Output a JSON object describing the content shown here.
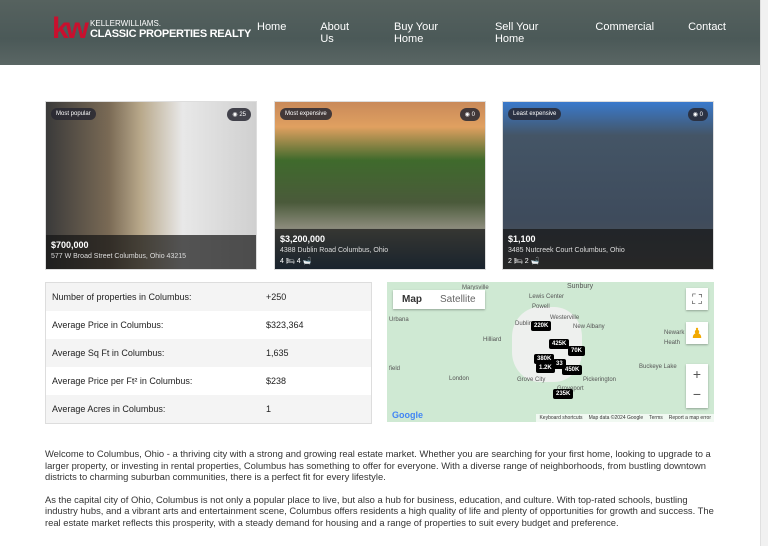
{
  "header": {
    "logo": {
      "mark": "kw",
      "line1": "KELLERWILLIAMS.",
      "line2": "CLASSIC PROPERTIES REALTY"
    },
    "nav": [
      "Home",
      "About Us",
      "Buy Your Home",
      "Sell Your Home",
      "Commercial",
      "Contact"
    ]
  },
  "cards": [
    {
      "badge": "Most popular",
      "views": "25",
      "price": "$700,000",
      "address": "577 W Broad Street Columbus, Ohio 43215",
      "beds": "",
      "baths": ""
    },
    {
      "badge": "Most expensive",
      "views": "0",
      "price": "$3,200,000",
      "address": "4388 Dublin Road Columbus, Ohio",
      "beds": "4",
      "baths": "4"
    },
    {
      "badge": "Least expensive",
      "views": "0",
      "price": "$1,100",
      "address": "3485 Nutcreek Court Columbus, Ohio",
      "beds": "2",
      "baths": "2"
    }
  ],
  "stats": [
    {
      "label": "Number of properties in Columbus:",
      "value": "+250"
    },
    {
      "label": "Average Price in Columbus:",
      "value": "$323,364"
    },
    {
      "label": "Average Sq Ft in Columbus:",
      "value": "1,635"
    },
    {
      "label": "Average Price per Ft² in Columbus:",
      "value": "$238"
    },
    {
      "label": "Average Acres in Columbus:",
      "value": "1"
    }
  ],
  "map": {
    "tabs": [
      "Map",
      "Satellite"
    ],
    "towns": [
      "Marysville",
      "Sunbury",
      "Lewis Center",
      "Powell",
      "Westerville",
      "Urbana",
      "Dublin",
      "New Albany",
      "Hilliard",
      "Newark",
      "Heath",
      "Buckeye Lake",
      "London",
      "Grove City",
      "Pickerington",
      "Groveport",
      "field"
    ],
    "pins": [
      "220K",
      "425K",
      "70K",
      "380K",
      "1.2K",
      "33",
      "450K",
      "235K"
    ],
    "attribution": [
      "Keyboard shortcuts",
      "Map data ©2024 Google",
      "Terms",
      "Report a map error"
    ],
    "brand": "Google"
  },
  "description": [
    "Welcome to Columbus, Ohio - a thriving city with a strong and growing real estate market. Whether you are searching for your first home, looking to upgrade to a larger property, or investing in rental properties, Columbus has something to offer for everyone. With a diverse range of neighborhoods, from bustling downtown districts to charming suburban communities, there is a perfect fit for every lifestyle.",
    "As the capital city of Ohio, Columbus is not only a popular place to live, but also a hub for business, education, and culture. With top-rated schools, bustling industry hubs, and a vibrant arts and entertainment scene, Columbus offers residents a high quality of life and plenty of opportunities for growth and success. The real estate market reflects this prosperity, with a steady demand for housing and a range of properties to suit every budget and preference."
  ]
}
